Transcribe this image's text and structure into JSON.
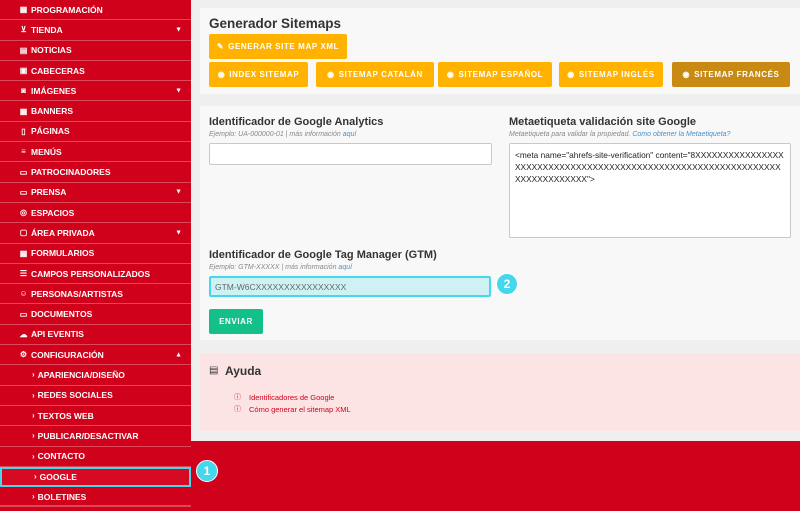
{
  "sidebar": {
    "items": [
      {
        "label": "PROGRAMACIÓN",
        "icon": "table-icon",
        "glyph": "▦",
        "caret": false
      },
      {
        "label": "TIENDA",
        "icon": "cart-icon",
        "glyph": "⊻",
        "caret": true
      },
      {
        "label": "NOTICIAS",
        "icon": "newspaper-icon",
        "glyph": "▤",
        "caret": false
      },
      {
        "label": "CABECERAS",
        "icon": "image-icon",
        "glyph": "▣",
        "caret": false
      },
      {
        "label": "IMÁGENES",
        "icon": "camera-icon",
        "glyph": "◙",
        "caret": true
      },
      {
        "label": "BANNERS",
        "icon": "grid-icon",
        "glyph": "▦",
        "caret": false
      },
      {
        "label": "PÁGINAS",
        "icon": "page-icon",
        "glyph": "▯",
        "caret": false
      },
      {
        "label": "MENÚS",
        "icon": "menu-icon",
        "glyph": "≡",
        "caret": false
      },
      {
        "label": "PATROCINADORES",
        "icon": "money-icon",
        "glyph": "▭",
        "caret": false
      },
      {
        "label": "PRENSA",
        "icon": "folder-icon",
        "glyph": "▭",
        "caret": true
      },
      {
        "label": "ESPACIOS",
        "icon": "location-pin-icon",
        "glyph": "◎",
        "caret": false
      },
      {
        "label": "ÁREA PRIVADA",
        "icon": "lock-icon",
        "glyph": "▢",
        "caret": true
      },
      {
        "label": "FORMULARIOS",
        "icon": "form-icon",
        "glyph": "▦",
        "caret": false
      },
      {
        "label": "CAMPOS PERSONALIZADOS",
        "icon": "list-icon",
        "glyph": "☰",
        "caret": false
      },
      {
        "label": "PERSONAS/ARTISTAS",
        "icon": "users-icon",
        "glyph": "☺",
        "caret": false
      },
      {
        "label": "DOCUMENTOS",
        "icon": "document-folder-icon",
        "glyph": "▭",
        "caret": false
      },
      {
        "label": "API EVENTIS",
        "icon": "cloud-icon",
        "glyph": "☁",
        "caret": false
      },
      {
        "label": "CONFIGURACIÓN",
        "icon": "gear-icon",
        "glyph": "⚙",
        "caret": true,
        "expanded": true
      }
    ],
    "sub_items": [
      {
        "label": "APARIENCIA/DISEÑO"
      },
      {
        "label": "REDES SOCIALES"
      },
      {
        "label": "TEXTOS WEB"
      },
      {
        "label": "PUBLICAR/DESACTIVAR"
      },
      {
        "label": "CONTACTO"
      },
      {
        "label": "GOOGLE",
        "active": true
      },
      {
        "label": "BOLETINES"
      }
    ]
  },
  "sitemaps": {
    "title": "Generador Sitemaps",
    "generate_label": "GENERAR SITE MAP XML",
    "buttons": [
      {
        "label": "INDEX SITEMAP"
      },
      {
        "label": "SITEMAP CATALÁN"
      },
      {
        "label": "SITEMAP ESPAÑOL"
      },
      {
        "label": "SITEMAP INGLÉS"
      },
      {
        "label": "SITEMAP FRANCÉS"
      }
    ]
  },
  "config": {
    "ga_label": "Identificador de Google Analytics",
    "ga_hint": "Ejemplo: UA-000000-01 | más información ",
    "ga_hint_link": "aquí",
    "ga_value": "",
    "meta_label": "Metaetiqueta validación site Google",
    "meta_hint": "Metaetiqueta para validar la propiedad. ",
    "meta_hint_link": "Como obtener la Metaetiqueta?",
    "meta_value": "<meta name=\"ahrefs-site-verification\" content=\"8XXXXXXXXXXXXXXXXXXXXXXXXXXXXXXXXXXXXXXXXXXXXXXXXXXXXXXXXXXXXXXXXXXXXXXXXXXXXX\">",
    "gtm_label": "Identificador de Google Tag Manager (GTM)",
    "gtm_hint": "Ejemplo: GTM-XXXXX | más información ",
    "gtm_hint_link": "aquí",
    "gtm_value": "GTM-W6CXXXXXXXXXXXXXXXX",
    "send_label": "ENVIAR"
  },
  "help": {
    "title": "Ayuda",
    "links": [
      {
        "label": "Identificadores de Google"
      },
      {
        "label": "Cómo generar el sitemap XML"
      }
    ]
  },
  "markers": [
    "1",
    "2"
  ],
  "colors": {
    "brand_red": "#d0011b",
    "amber": "#ffb200",
    "amber_dark": "#c88a13",
    "send_green": "#14c08a",
    "highlight_cyan": "#45d7ec"
  }
}
